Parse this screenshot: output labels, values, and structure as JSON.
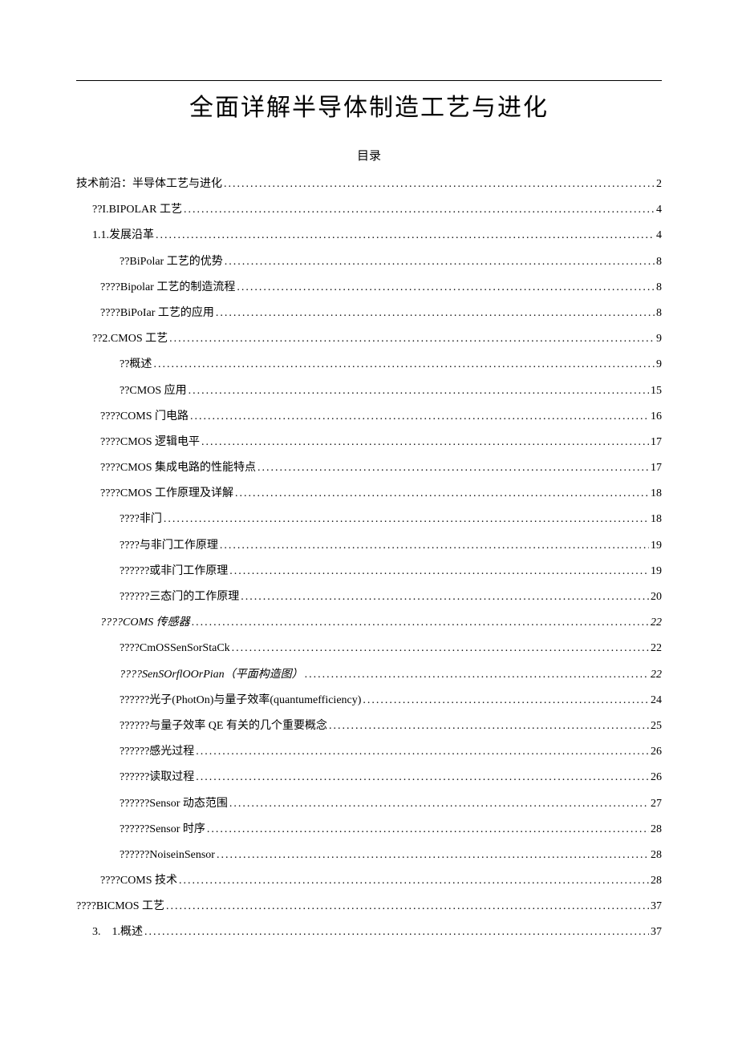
{
  "title": "全面详解半导体制造工艺与进化",
  "toc_heading": "目录",
  "toc": [
    {
      "label": "技术前沿：半导体工艺与进化",
      "page": "2",
      "indent": 0,
      "italic": false
    },
    {
      "label": "??I.BIPOLAR 工艺",
      "page": "4",
      "indent": 1,
      "italic": false
    },
    {
      "label": "1.1.发展沿革",
      "page": "4",
      "indent": 1,
      "italic": false
    },
    {
      "label": "??BiPolar 工艺的优势",
      "page": "8",
      "indent": 2,
      "italic": false
    },
    {
      "label": "????Bipolar 工艺的制造流程",
      "page": "8",
      "indent": 3,
      "italic": false
    },
    {
      "label": "????BiPoIar 工艺的应用",
      "page": "8",
      "indent": 3,
      "italic": false
    },
    {
      "label": "??2.CMOS 工艺",
      "page": "9",
      "indent": 1,
      "italic": false
    },
    {
      "label": "??概述",
      "page": "9",
      "indent": 2,
      "italic": false
    },
    {
      "label": "??CMOS 应用",
      "page": "15",
      "indent": 2,
      "italic": false
    },
    {
      "label": "????COMS 门电路",
      "page": "16",
      "indent": 3,
      "italic": false
    },
    {
      "label": "????CMOS 逻辑电平",
      "page": "17",
      "indent": 3,
      "italic": false
    },
    {
      "label": "????CMOS 集成电路的性能特点",
      "page": "17",
      "indent": 3,
      "italic": false
    },
    {
      "label": "????CMOS 工作原理及详解",
      "page": "18",
      "indent": 3,
      "italic": false
    },
    {
      "label": "????非门",
      "page": "18",
      "indent": 4,
      "italic": false
    },
    {
      "label": "????与非门工作原理",
      "page": "19",
      "indent": 4,
      "italic": false
    },
    {
      "label": "??????或非门工作原理",
      "page": "19",
      "indent": 4,
      "italic": false
    },
    {
      "label": "??????三态门的工作原理",
      "page": "20",
      "indent": 4,
      "italic": false
    },
    {
      "label": "????COMS 传感器",
      "page": "22",
      "indent": 3,
      "italic": true
    },
    {
      "label": "????CmOSSenSorStaCk",
      "page": "22",
      "indent": 4,
      "italic": false
    },
    {
      "label": "????SenSOrflOOrPian（平面构造图）",
      "page": "22",
      "indent": 4,
      "italic": true
    },
    {
      "label": "??????光子(PhotOn)与量子效率(quantumefficiency)",
      "page": "24",
      "indent": 4,
      "italic": false
    },
    {
      "label": "??????与量子效率 QE 有关的几个重要概念",
      "page": "25",
      "indent": 4,
      "italic": false
    },
    {
      "label": "??????感光过程",
      "page": "26",
      "indent": 4,
      "italic": false
    },
    {
      "label": "??????读取过程",
      "page": "26",
      "indent": 4,
      "italic": false
    },
    {
      "label": "??????Sensor 动态范围",
      "page": "27",
      "indent": 4,
      "italic": false
    },
    {
      "label": "??????Sensor 时序",
      "page": "28",
      "indent": 4,
      "italic": false
    },
    {
      "label": "??????NoiseinSensor",
      "page": "28",
      "indent": 4,
      "italic": false
    },
    {
      "label": "????COMS 技术",
      "page": "28",
      "indent": 3,
      "italic": false
    },
    {
      "label": "????BICMOS 工艺",
      "page": "37",
      "indent": 0,
      "italic": false
    },
    {
      "label": "3.　1.概述",
      "page": "37",
      "indent": 1,
      "italic": false
    }
  ]
}
